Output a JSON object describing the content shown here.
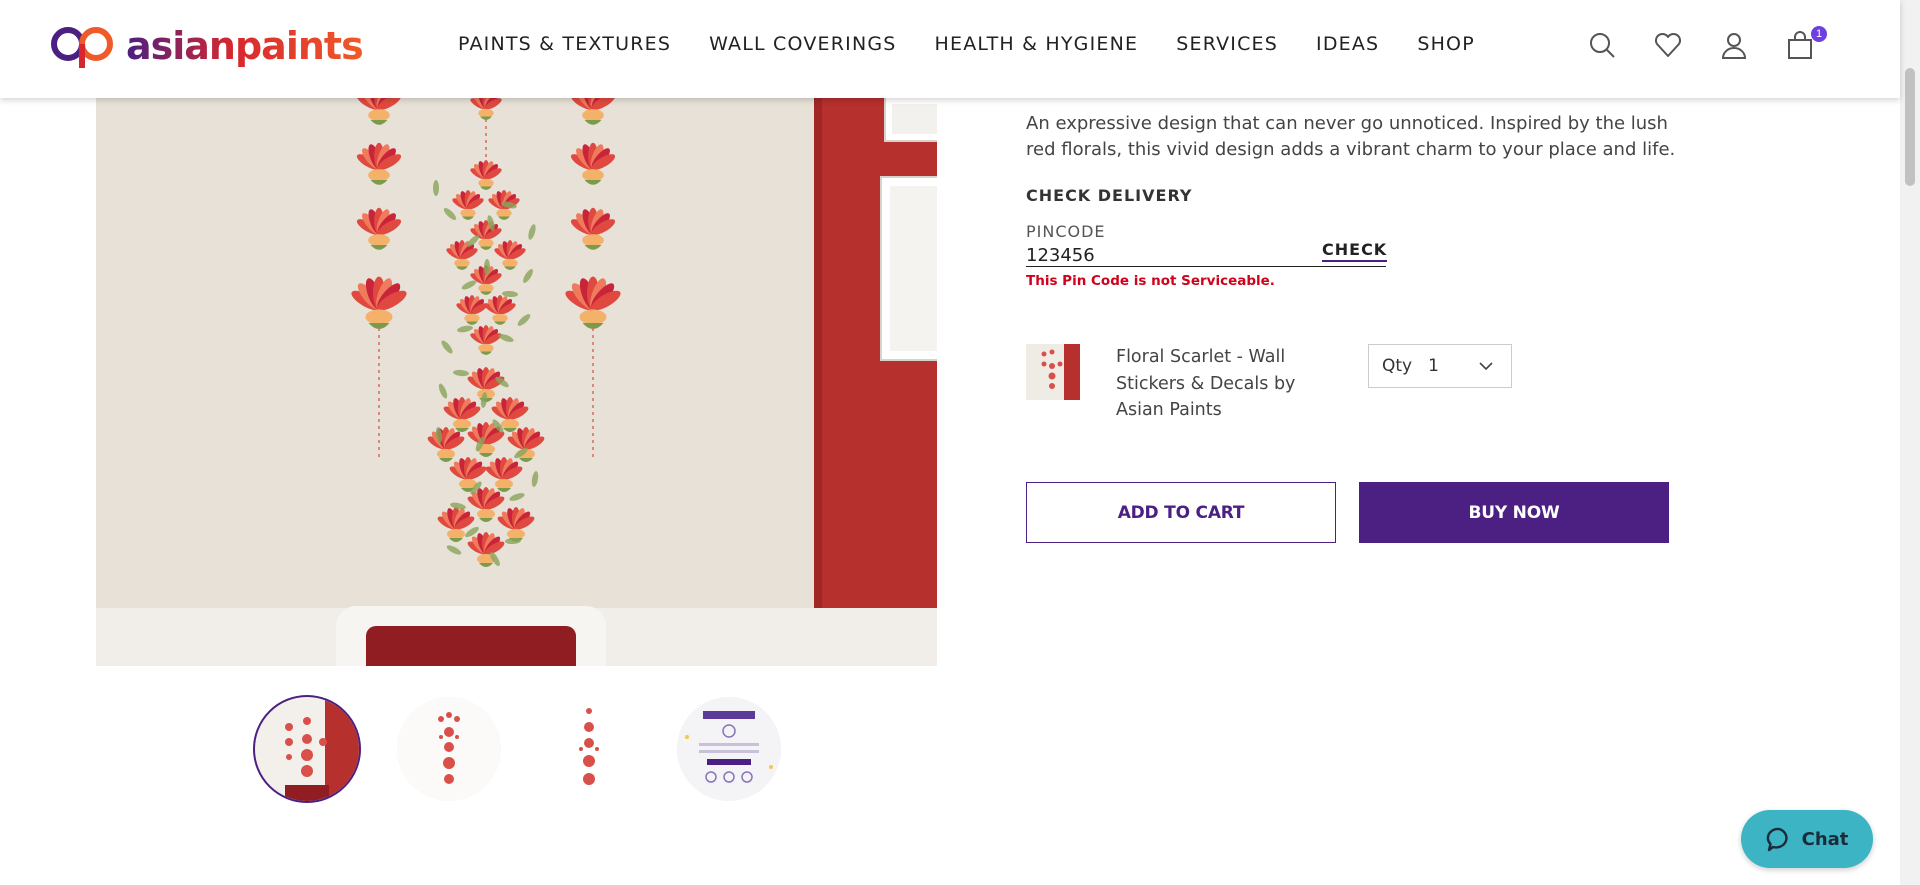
{
  "brand": {
    "name": "asianpaints",
    "colors": {
      "primary": "#4b2082",
      "logo_orange": "#f05a28",
      "logo_red": "#d7272e",
      "error": "#d0021b",
      "chat": "#3cb4c4"
    }
  },
  "nav": {
    "items": [
      "PAINTS & TEXTURES",
      "WALL COVERINGS",
      "HEALTH & HYGIENE",
      "SERVICES",
      "IDEAS",
      "SHOP"
    ]
  },
  "header_icons": {
    "search": "search-icon",
    "wishlist": "heart-icon",
    "account": "user-icon",
    "cart": "cart-icon",
    "cart_count": "1"
  },
  "product": {
    "description": "An expressive design that can never go unnoticed. Inspired by the lush red florals, this vivid design adds a vibrant charm to your place and life.",
    "name": "Floral Scarlet - Wall Stickers & Decals by Asian Paints",
    "qty_label": "Qty",
    "qty_value": "1"
  },
  "delivery": {
    "title": "CHECK DELIVERY",
    "pincode_label": "PINCODE",
    "pincode_value": "123456",
    "check_label": "CHECK",
    "error": "This Pin Code is not Serviceable."
  },
  "actions": {
    "add_to_cart": "ADD TO CART",
    "buy_now": "BUY NOW"
  },
  "gallery": {
    "thumbnail_count": 4,
    "active_index": 0
  },
  "chat": {
    "label": "Chat",
    "icon": "chat-bubble-icon"
  }
}
